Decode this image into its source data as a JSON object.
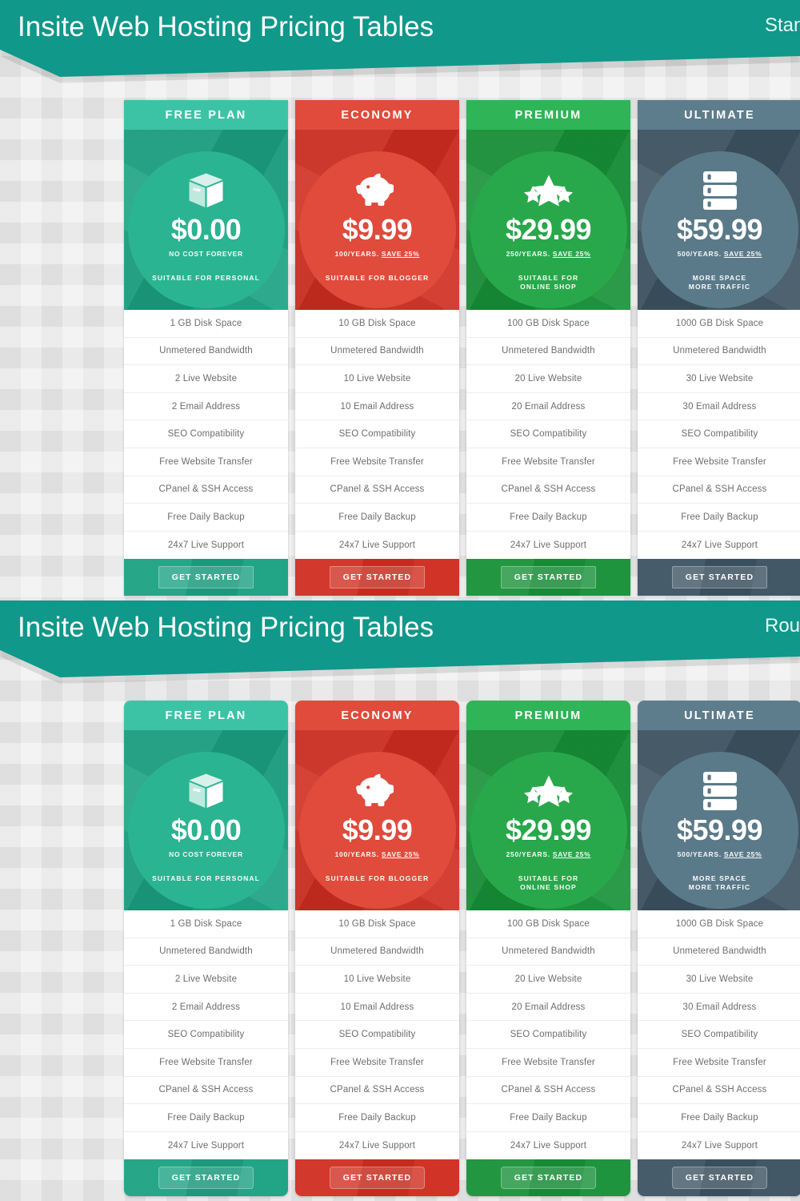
{
  "sections": [
    {
      "title": "Insite Web Hosting Pricing Tables",
      "variant_label": "Standard",
      "rounded": false
    },
    {
      "title": "Insite Web Hosting Pricing Tables",
      "variant_label": "Rounded",
      "rounded": true
    }
  ],
  "cta_label": "GET STARTED",
  "colors": {
    "banner": "#10988a",
    "page_background": "#e4e4e4",
    "free_head": "#3cc3a5",
    "free_body": "#1ba182",
    "free_circle": "#2bb491",
    "economy_head": "#e04b3c",
    "economy_body": "#d02d20",
    "economy_circle": "#e04b3c",
    "premium_head": "#2fb457",
    "premium_body": "#179138",
    "premium_circle": "#28a84b",
    "ultimate_head": "#5e7d8c",
    "ultimate_body": "#3d5362",
    "ultimate_circle": "#5b7a89"
  },
  "plans": [
    {
      "name": "FREE PLAN",
      "icon": "box-icon",
      "price": "$0.00",
      "per": "NO COST FOREVER",
      "per_plain": "NO COST FOREVER",
      "per_underline": "",
      "suitable": "SUITABLE FOR PERSONAL",
      "features": [
        "1 GB Disk Space",
        "Unmetered Bandwidth",
        "2 Live Website",
        "2 Email Address",
        "SEO Compatibility",
        "Free Website Transfer",
        "CPanel & SSH Access",
        "Free Daily Backup",
        "24x7 Live Support"
      ]
    },
    {
      "name": "ECONOMY",
      "icon": "piggy-bank-icon",
      "price": "$9.99",
      "per": "100/YEARS. SAVE 25%",
      "per_plain": "100/YEARS. ",
      "per_underline": "SAVE 25%",
      "suitable": "SUITABLE FOR BLOGGER",
      "features": [
        "10 GB Disk Space",
        "Unmetered Bandwidth",
        "10 Live Website",
        "10 Email Address",
        "SEO Compatibility",
        "Free Website Transfer",
        "CPanel & SSH Access",
        "Free Daily Backup",
        "24x7 Live Support"
      ]
    },
    {
      "name": "PREMIUM",
      "icon": "stars-icon",
      "price": "$29.99",
      "per": "250/YEARS. SAVE 25%",
      "per_plain": "250/YEARS. ",
      "per_underline": "SAVE 25%",
      "suitable": "SUITABLE FOR\nONLINE SHOP",
      "features": [
        "100 GB Disk Space",
        "Unmetered Bandwidth",
        "20 Live Website",
        "20 Email Address",
        "SEO Compatibility",
        "Free Website Transfer",
        "CPanel & SSH Access",
        "Free Daily Backup",
        "24x7 Live Support"
      ]
    },
    {
      "name": "ULTIMATE",
      "icon": "server-icon",
      "price": "$59.99",
      "per": "500/YEARS. SAVE 25%",
      "per_plain": "500/YEARS. ",
      "per_underline": "SAVE 25%",
      "suitable": "MORE SPACE\nMORE TRAFFIC",
      "features": [
        "1000 GB Disk Space",
        "Unmetered Bandwidth",
        "30 Live Website",
        "30 Email Address",
        "SEO Compatibility",
        "Free Website Transfer",
        "CPanel & SSH Access",
        "Free Daily Backup",
        "24x7 Live Support"
      ]
    }
  ]
}
